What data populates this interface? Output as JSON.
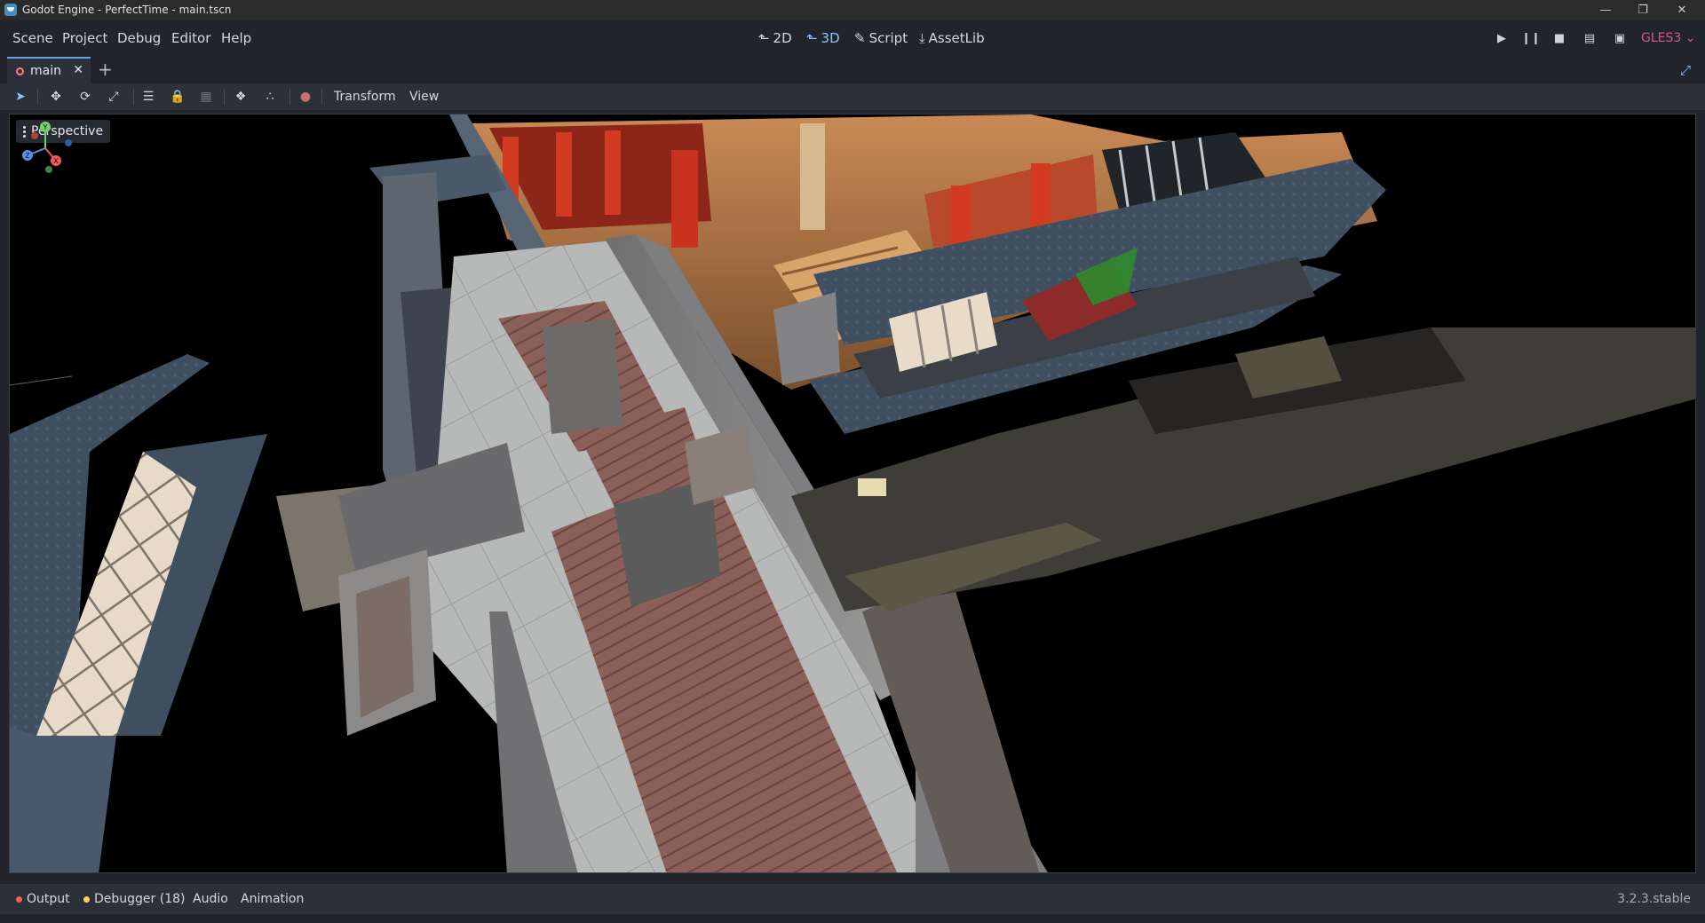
{
  "window": {
    "title": "Godot Engine - PerfectTime - main.tscn"
  },
  "menus": [
    "Scene",
    "Project",
    "Debug",
    "Editor",
    "Help"
  ],
  "workspaces": [
    {
      "label": "2D",
      "icon": "2d-icon"
    },
    {
      "label": "3D",
      "icon": "3d-icon",
      "active": true
    },
    {
      "label": "Script",
      "icon": "script-icon"
    },
    {
      "label": "AssetLib",
      "icon": "assetlib-icon"
    }
  ],
  "renderer": "GLES3",
  "tabs": {
    "current": "main"
  },
  "toolbar": {
    "transform_menu": "Transform",
    "view_menu": "View"
  },
  "viewport": {
    "perspective_label": "Perspective"
  },
  "gizmo_axes": {
    "x": "X",
    "y": "Y",
    "z": "Z"
  },
  "bottom_panel": {
    "tabs": [
      {
        "label": "Output",
        "dot_color": "#ff5d5d"
      },
      {
        "label": "Debugger (18)",
        "dot_color": "#ffd35d"
      },
      {
        "label": "Audio"
      },
      {
        "label": "Animation"
      }
    ],
    "version": "3.2.3.stable"
  },
  "colors": {
    "accent": "#699ce8",
    "renderer": "#d8568d"
  }
}
